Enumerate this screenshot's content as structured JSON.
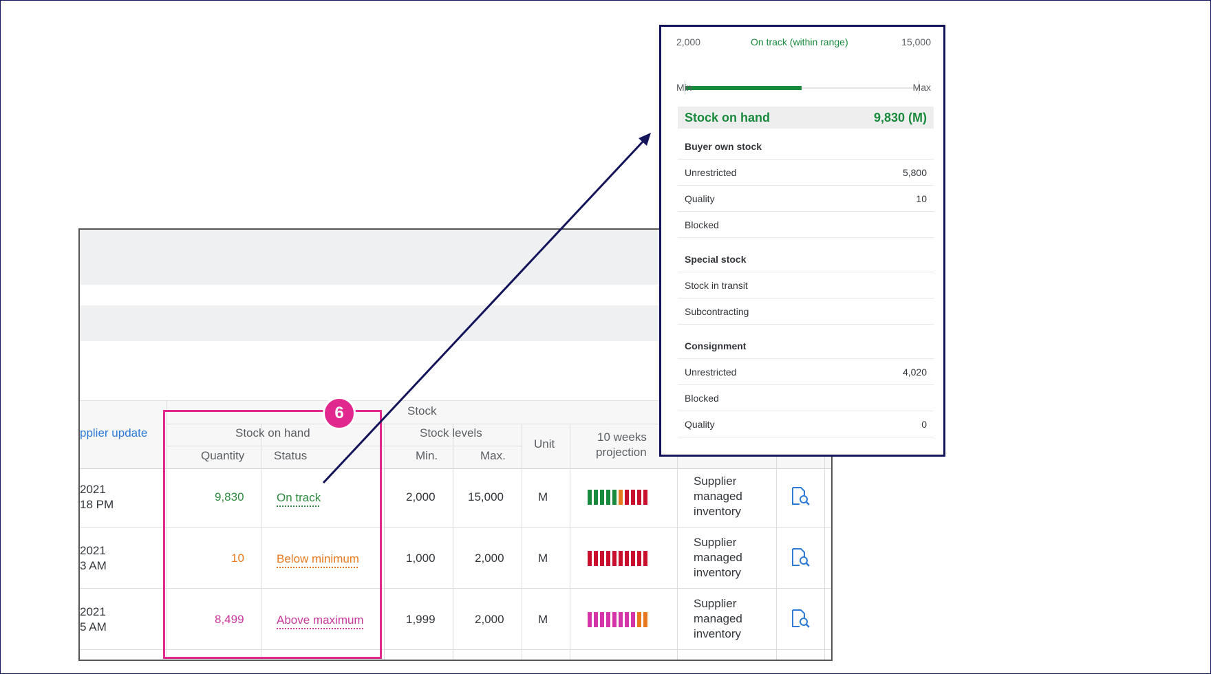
{
  "badge": "6",
  "table": {
    "header": {
      "supplier_update": "pplier update",
      "stock_group": "Stock",
      "stock_on_hand": "Stock on hand",
      "quantity": "Quantity",
      "status": "Status",
      "stock_levels": "Stock levels",
      "min": "Min.",
      "max": "Max.",
      "unit": "Unit",
      "projection_line1": "10 weeks",
      "projection_line2": "projection"
    },
    "rows": [
      {
        "date1": "2021",
        "date2": "18 PM",
        "qty": "9,830",
        "status": "On track",
        "min": "2,000",
        "max": "15,000",
        "unit": "M",
        "type1": "Supplier",
        "type2": "managed",
        "type3": "inventory",
        "color": "#2f8a41",
        "projection": [
          "#188a3c",
          "#188a3c",
          "#188a3c",
          "#188a3c",
          "#188a3c",
          "#e8781e",
          "#c8102e",
          "#c8102e",
          "#c8102e",
          "#c8102e"
        ]
      },
      {
        "date1": "2021",
        "date2": "3 AM",
        "qty": "10",
        "status": "Below minimum",
        "min": "1,000",
        "max": "2,000",
        "unit": "M",
        "type1": "Supplier",
        "type2": "managed",
        "type3": "inventory",
        "color": "#e8781e",
        "projection": [
          "#c8102e",
          "#c8102e",
          "#c8102e",
          "#c8102e",
          "#c8102e",
          "#c8102e",
          "#c8102e",
          "#c8102e",
          "#c8102e",
          "#c8102e"
        ]
      },
      {
        "date1": "2021",
        "date2": "5 AM",
        "qty": "8,499",
        "status": "Above maximum",
        "min": "1,999",
        "max": "2,000",
        "unit": "M",
        "type1": "Supplier",
        "type2": "managed",
        "type3": "inventory",
        "color": "#c8379a",
        "projection": [
          "#d436aa",
          "#d436aa",
          "#d436aa",
          "#d436aa",
          "#d436aa",
          "#d436aa",
          "#d436aa",
          "#d436aa",
          "#e8781e",
          "#e8781e"
        ]
      }
    ]
  },
  "popover": {
    "min_value": "2,000",
    "max_value": "15,000",
    "range_status": "On track (within range)",
    "min_label": "Min",
    "max_label": "Max",
    "fill_fraction": 0.5,
    "stock_on_hand_label": "Stock on hand",
    "stock_on_hand_value": "9,830 (M)",
    "sections": [
      {
        "title": "Buyer own stock",
        "rows": [
          {
            "label": "Unrestricted",
            "value": "5,800"
          },
          {
            "label": "Quality",
            "value": "10"
          },
          {
            "label": "Blocked",
            "value": ""
          }
        ]
      },
      {
        "title": "Special stock",
        "rows": [
          {
            "label": "Stock in transit",
            "value": ""
          },
          {
            "label": "Subcontracting",
            "value": ""
          }
        ]
      },
      {
        "title": "Consignment",
        "rows": [
          {
            "label": "Unrestricted",
            "value": "4,020"
          },
          {
            "label": "Blocked",
            "value": ""
          },
          {
            "label": "Quality",
            "value": "0"
          }
        ]
      }
    ]
  },
  "colors": {
    "accent_pink": "#e0288e",
    "navy": "#14145a",
    "green": "#188a3c"
  }
}
